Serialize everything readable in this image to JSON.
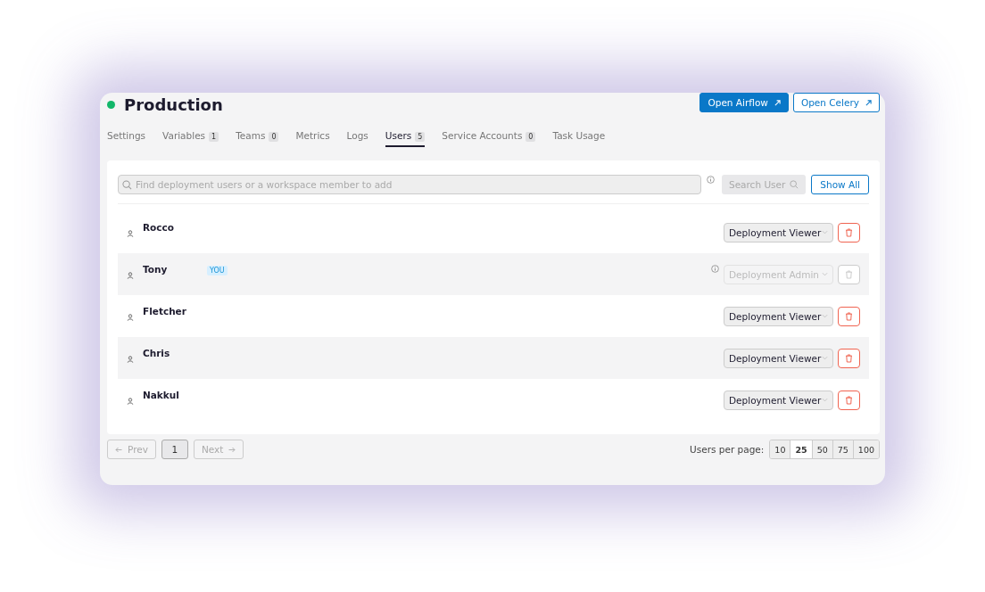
{
  "deployment": {
    "title": "Production",
    "online": true
  },
  "header_buttons": [
    {
      "label": "Open Airflow",
      "kind": "primary"
    },
    {
      "label": "Open Celery",
      "kind": "outline"
    }
  ],
  "tabs": [
    {
      "label": "Settings",
      "selected": false
    },
    {
      "label": "Variables",
      "count": "1",
      "selected": false
    },
    {
      "label": "Teams",
      "count": "0",
      "selected": false
    },
    {
      "label": "Metrics",
      "selected": false
    },
    {
      "label": "Logs",
      "selected": false
    },
    {
      "label": "Users",
      "count": "5",
      "selected": true
    },
    {
      "label": "Service Accounts",
      "count": "0",
      "selected": false
    },
    {
      "label": "Task Usage",
      "selected": false
    }
  ],
  "search": {
    "placeholder": "Find deployment users or a workspace member to add",
    "button": "Search User",
    "show_all": "Show All"
  },
  "users": [
    {
      "name": "Rocco",
      "role": "Deployment Viewer",
      "disabled": false
    },
    {
      "name": "Tony",
      "badge": "YOU",
      "role": "Deployment Admin",
      "disabled": true
    },
    {
      "name": "Fletcher",
      "role": "Deployment Viewer",
      "disabled": false
    },
    {
      "name": "Chris",
      "role": "Deployment Viewer",
      "disabled": false
    },
    {
      "name": "Nakkul",
      "role": "Deployment Viewer",
      "disabled": false
    }
  ],
  "pagination": {
    "prev": "Prev",
    "next": "Next",
    "prev_disabled": true,
    "next_disabled": true,
    "pages": [
      {
        "label": "1",
        "selected": true
      }
    ]
  },
  "per_page": {
    "label": "Users per page:",
    "options": [
      {
        "label": "10",
        "selected": false
      },
      {
        "label": "25",
        "selected": true
      },
      {
        "label": "50",
        "selected": false
      },
      {
        "label": "75",
        "selected": false
      },
      {
        "label": "100",
        "selected": false
      }
    ]
  }
}
